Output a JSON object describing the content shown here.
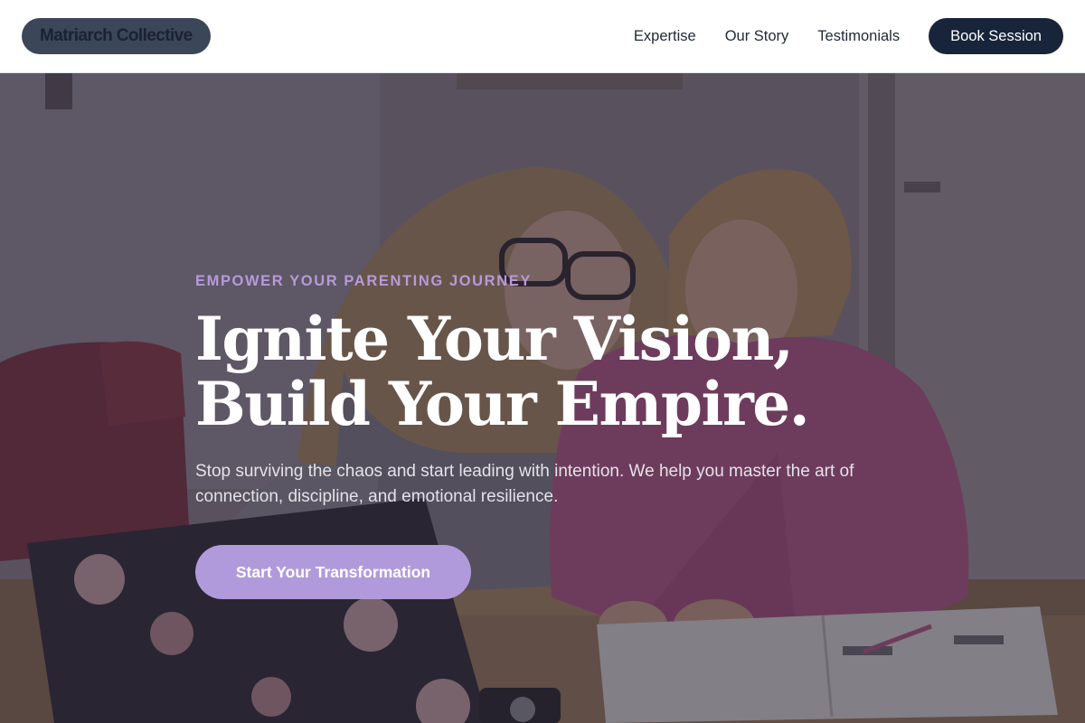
{
  "header": {
    "brand": "Matriarch Collective",
    "nav": [
      "Expertise",
      "Our Story",
      "Testimonials"
    ],
    "cta": "Book Session"
  },
  "hero": {
    "eyebrow": "EMPOWER YOUR PARENTING JOURNEY",
    "headline_line1": "Ignite Your Vision,",
    "headline_line2": "Build Your Empire.",
    "subtext": "Stop surviving the chaos and start leading with intention. We help you master the art of connection, discipline, and emotional resilience.",
    "cta": "Start Your Transformation",
    "background": "photo-mother-and-daughter-studying"
  },
  "colors": {
    "brand_pill": "#3b4658",
    "book_button": "#18243a",
    "accent": "#b19adb",
    "eyebrow": "#b79ad9",
    "pink_sweater": "#b35585"
  }
}
